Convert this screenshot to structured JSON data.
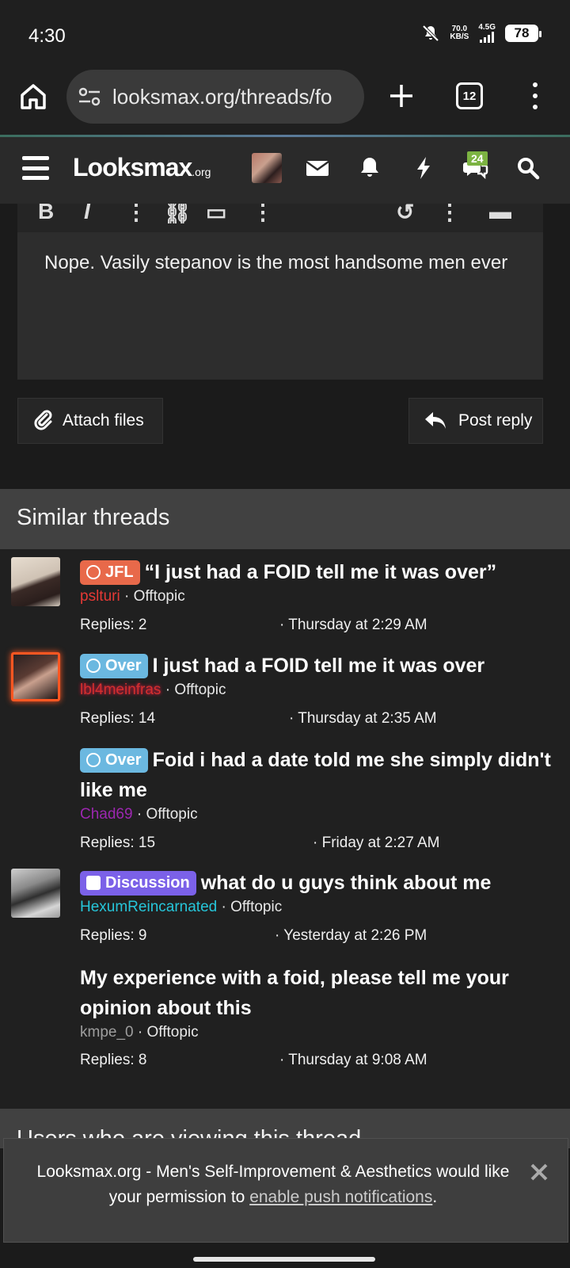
{
  "status_bar": {
    "time": "4:30",
    "speed_value": "70.0",
    "speed_unit": "KB/S",
    "network": "4.5G",
    "battery": "78"
  },
  "browser": {
    "url": "looksmax.org/threads/fo",
    "tab_count": "12"
  },
  "site_header": {
    "logo_main": "Looksmax",
    "logo_suffix": ".org",
    "conversations_badge": "24"
  },
  "editor": {
    "text": "Nope. Vasily stepanov is the most handsome men ever",
    "attach_label": "Attach files",
    "post_label": "Post reply"
  },
  "similar_threads": {
    "heading": "Similar threads",
    "threads": [
      {
        "prefix": "JFL",
        "title": "“I just had a FOID tell me it was over”",
        "user": "pslturi",
        "forum": "· Offtopic",
        "replies": "Replies: 2",
        "date": "· Thursday at 2:29 AM"
      },
      {
        "prefix": "Over",
        "title": "I just had a FOID tell me it was over",
        "user": "lbl4meinfras",
        "forum": "· Offtopic",
        "replies": "Replies: 14",
        "date": "· Thursday at 2:35 AM"
      },
      {
        "prefix": "Over",
        "title": "Foid i had a date told me she simply didn't like me",
        "user": "Chad69",
        "forum": "· Offtopic",
        "replies": "Replies: 15",
        "date": "· Friday at 2:27 AM"
      },
      {
        "prefix": "Discussion",
        "title": "what do u guys think about me",
        "user": "HexumReincarnated",
        "forum": "· Offtopic",
        "replies": "Replies: 9",
        "date": "· Yesterday at 2:26 PM"
      },
      {
        "prefix": "",
        "title": "My experience with a foid, please tell me your opinion about this",
        "user": "kmpe_0",
        "forum": "· Offtopic",
        "replies": "Replies: 8",
        "date": "· Thursday at 9:08 AM"
      }
    ]
  },
  "viewing": {
    "heading": "Users who are viewing this thread"
  },
  "notification": {
    "message_pre": "Looksmax.org - Men's Self-Improvement & Aesthetics would like your permission to ",
    "link": "enable push notifications",
    "message_post": "."
  },
  "colors": {
    "jfl_prefix": "#e8694a",
    "over_prefix": "#6bb8e0",
    "discussion_prefix": "#7b61e8",
    "user_red": "#e53935",
    "user_purple": "#9c27b0",
    "user_cyan": "#26c6da",
    "user_gray": "#9e9e9e",
    "badge_green": "#7cb342"
  }
}
